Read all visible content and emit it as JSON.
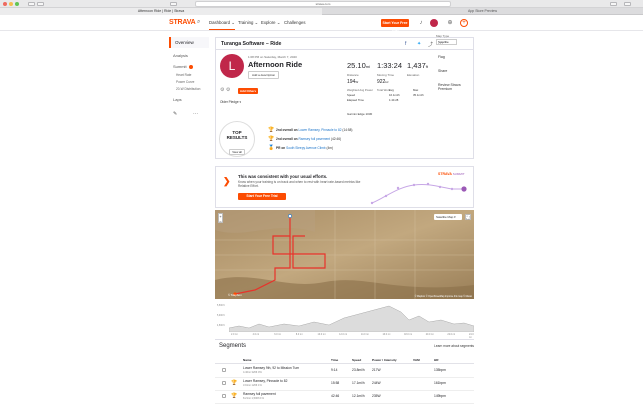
{
  "browser": {
    "url": "strava.com",
    "tabs": [
      "Afternoon Ride | Ride | Strava",
      "App Store Preview"
    ]
  },
  "nav": {
    "logo": "STRAVA",
    "items": [
      "Dashboard ⌄",
      "Training ⌄",
      "Explore ⌄",
      "Challenges"
    ],
    "trial_button": "Start Your Free Trial"
  },
  "sidebar": {
    "overview": "Overview",
    "analysis": "Analysis",
    "summit": "Summit",
    "sub_items": [
      "Heart Rate",
      "Power Curve",
      "20-W Distribution"
    ],
    "laps": "Laps"
  },
  "activity": {
    "header": "Turanga Software – Ride",
    "avatar_letter": "L",
    "date": "1:08 PM on Saturday, March 7, 2020",
    "title": "Afternoon Ride",
    "add_description": "Add a description",
    "add_others": "Add Others",
    "older_pledge": "Older Pledge ▾",
    "distance": "25.10",
    "distance_unit": "mi",
    "distance_label": "Distance",
    "moving_time": "1:33:24",
    "moving_time_label": "Moving Time",
    "elevation": "1,437",
    "elevation_unit": "ft",
    "elevation_label": "Elevation",
    "weighted_power": "194",
    "weighted_power_unit": "W",
    "weighted_power_label": "Weighted Avg Power",
    "total_work": "922",
    "total_work_unit": "kJ",
    "total_work_label": "Total Work",
    "table_head": [
      "",
      "Avg",
      "Max"
    ],
    "speed_row": [
      "Speed",
      "16.1mi/h",
      "35.1mi/h"
    ],
    "elapsed_row": [
      "Elapsed Time",
      "1:44:28",
      ""
    ],
    "sprint": "Garmin Edge 1030"
  },
  "top_results": {
    "line1": "TOP",
    "line2": "RESULTS",
    "view_all": "View all",
    "achievements": [
      {
        "prefix": "2nd overall on ",
        "link": "Lower Ramsey, Pinnacle to 82",
        "suffix": " (14:58)"
      },
      {
        "prefix": "2nd overall on ",
        "link": "Ramsey full pavement",
        "suffix": " (42:46)"
      },
      {
        "prefix": "PR on ",
        "link": "South Sleepy Avenue Climb",
        "suffix": " (4m)"
      }
    ]
  },
  "right_menu": {
    "label": "Map Type",
    "select": "Satellite",
    "items": [
      "Flag",
      "Share",
      "Review Strava Premium"
    ]
  },
  "promo": {
    "heading": "This was consistent with your usual efforts.",
    "body": "Know when your training is on track and when to rest with heart rate-based metrics like Relative Effort.",
    "button": "Start Your Free Trial",
    "brand": "STRAVA",
    "brand_sub": "SUMMIT"
  },
  "map": {
    "style": "Satellite Map ▾",
    "logo": "© Mapbox",
    "credit": "© Mapbox © OpenStreetMap Improve this map © Maxar"
  },
  "elevation_chart": {
    "y_labels": [
      "5,500 ft",
      "5,000 ft",
      "4,500 ft"
    ],
    "x_labels": [
      "2.0 mi",
      "4.0 mi",
      "6.0 mi",
      "8.0 mi",
      "10.0 mi",
      "12.0 mi",
      "14.0 mi",
      "16.0 mi",
      "18.0 mi",
      "20.0 mi",
      "22.0 mi",
      "24.0 mi"
    ]
  },
  "segments": {
    "title": "Segments",
    "learn_more": "Learn more about segments",
    "headers": [
      "Name",
      "Time",
      "Speed",
      "Power / Intensity",
      "VAM",
      "HR"
    ],
    "rows": [
      {
        "name": "Lower Ramsey 9th, 92 to Mission Turn",
        "sub": "4.40mi  326ft  0%",
        "time": "9:14",
        "speed": "23.8mi/h",
        "power": "217W",
        "vam": "",
        "hr": "135bpm",
        "cup": false
      },
      {
        "name": "Lower Ramsey, Pinnacle to 82",
        "sub": "3.91mi  126ft  1%",
        "time": "15:58",
        "speed": "17.1mi/h",
        "power": "244W",
        "vam": "",
        "hr": "161bpm",
        "cup": true
      },
      {
        "name": "Ramsey full pavement",
        "sub": "8.21mi  1,500ft  1%",
        "time": "42:46",
        "speed": "12.1mi/h",
        "power": "235W",
        "vam": "",
        "hr": "149bpm",
        "cup": true
      }
    ]
  },
  "colors": {
    "accent": "#fc4c02",
    "avatar": "#c0274a",
    "link": "#1a73c8",
    "route": "#e8322a"
  }
}
